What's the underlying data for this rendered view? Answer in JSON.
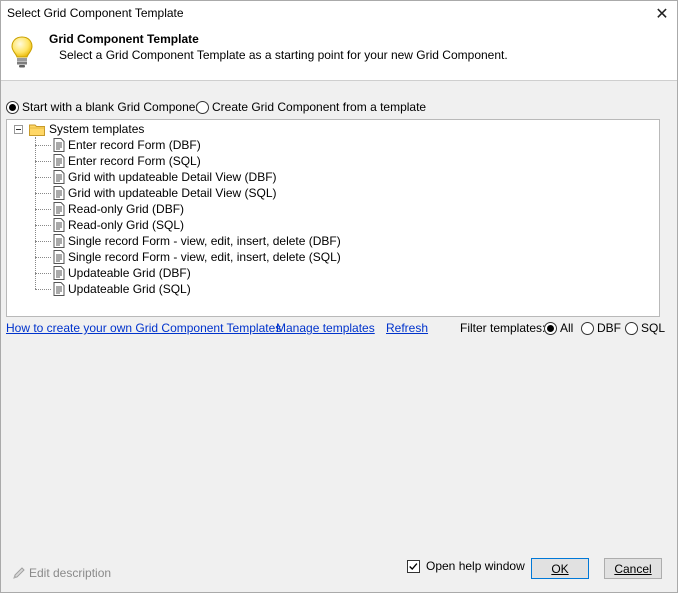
{
  "window": {
    "title": "Select Grid Component Template",
    "close_glyph": "✕"
  },
  "header": {
    "title": "Grid Component Template",
    "description": "Select a Grid Component Template as a starting point for your new Grid Component.",
    "icon": "lightbulb-icon"
  },
  "mode": {
    "blank_label": "Start with a blank Grid Component",
    "template_label": "Create Grid Component from a template",
    "selected": "blank"
  },
  "tree": {
    "root_label": "System templates",
    "items": [
      "Enter record Form (DBF)",
      "Enter record Form (SQL)",
      "Grid with updateable Detail View (DBF)",
      "Grid with updateable Detail View (SQL)",
      "Read-only Grid (DBF)",
      "Read-only Grid (SQL)",
      "Single record Form - view, edit, insert, delete (DBF)",
      "Single record Form - view, edit, insert, delete (SQL)",
      "Updateable Grid (DBF)",
      "Updateable Grid (SQL)"
    ]
  },
  "links": {
    "how_to": "How to create your own Grid Component Templates",
    "manage": "Manage templates",
    "refresh": "Refresh"
  },
  "filter": {
    "label": "Filter templates:",
    "all": "All",
    "dbf": "DBF",
    "sql": "SQL",
    "selected": "all"
  },
  "footer": {
    "edit_description": "Edit description",
    "open_help": "Open help window",
    "open_help_checked": true,
    "ok": "OK",
    "cancel": "Cancel"
  },
  "colors": {
    "link": "#0033cc",
    "ok_border": "#0078d7",
    "disabled_text": "#8a8a8a"
  }
}
